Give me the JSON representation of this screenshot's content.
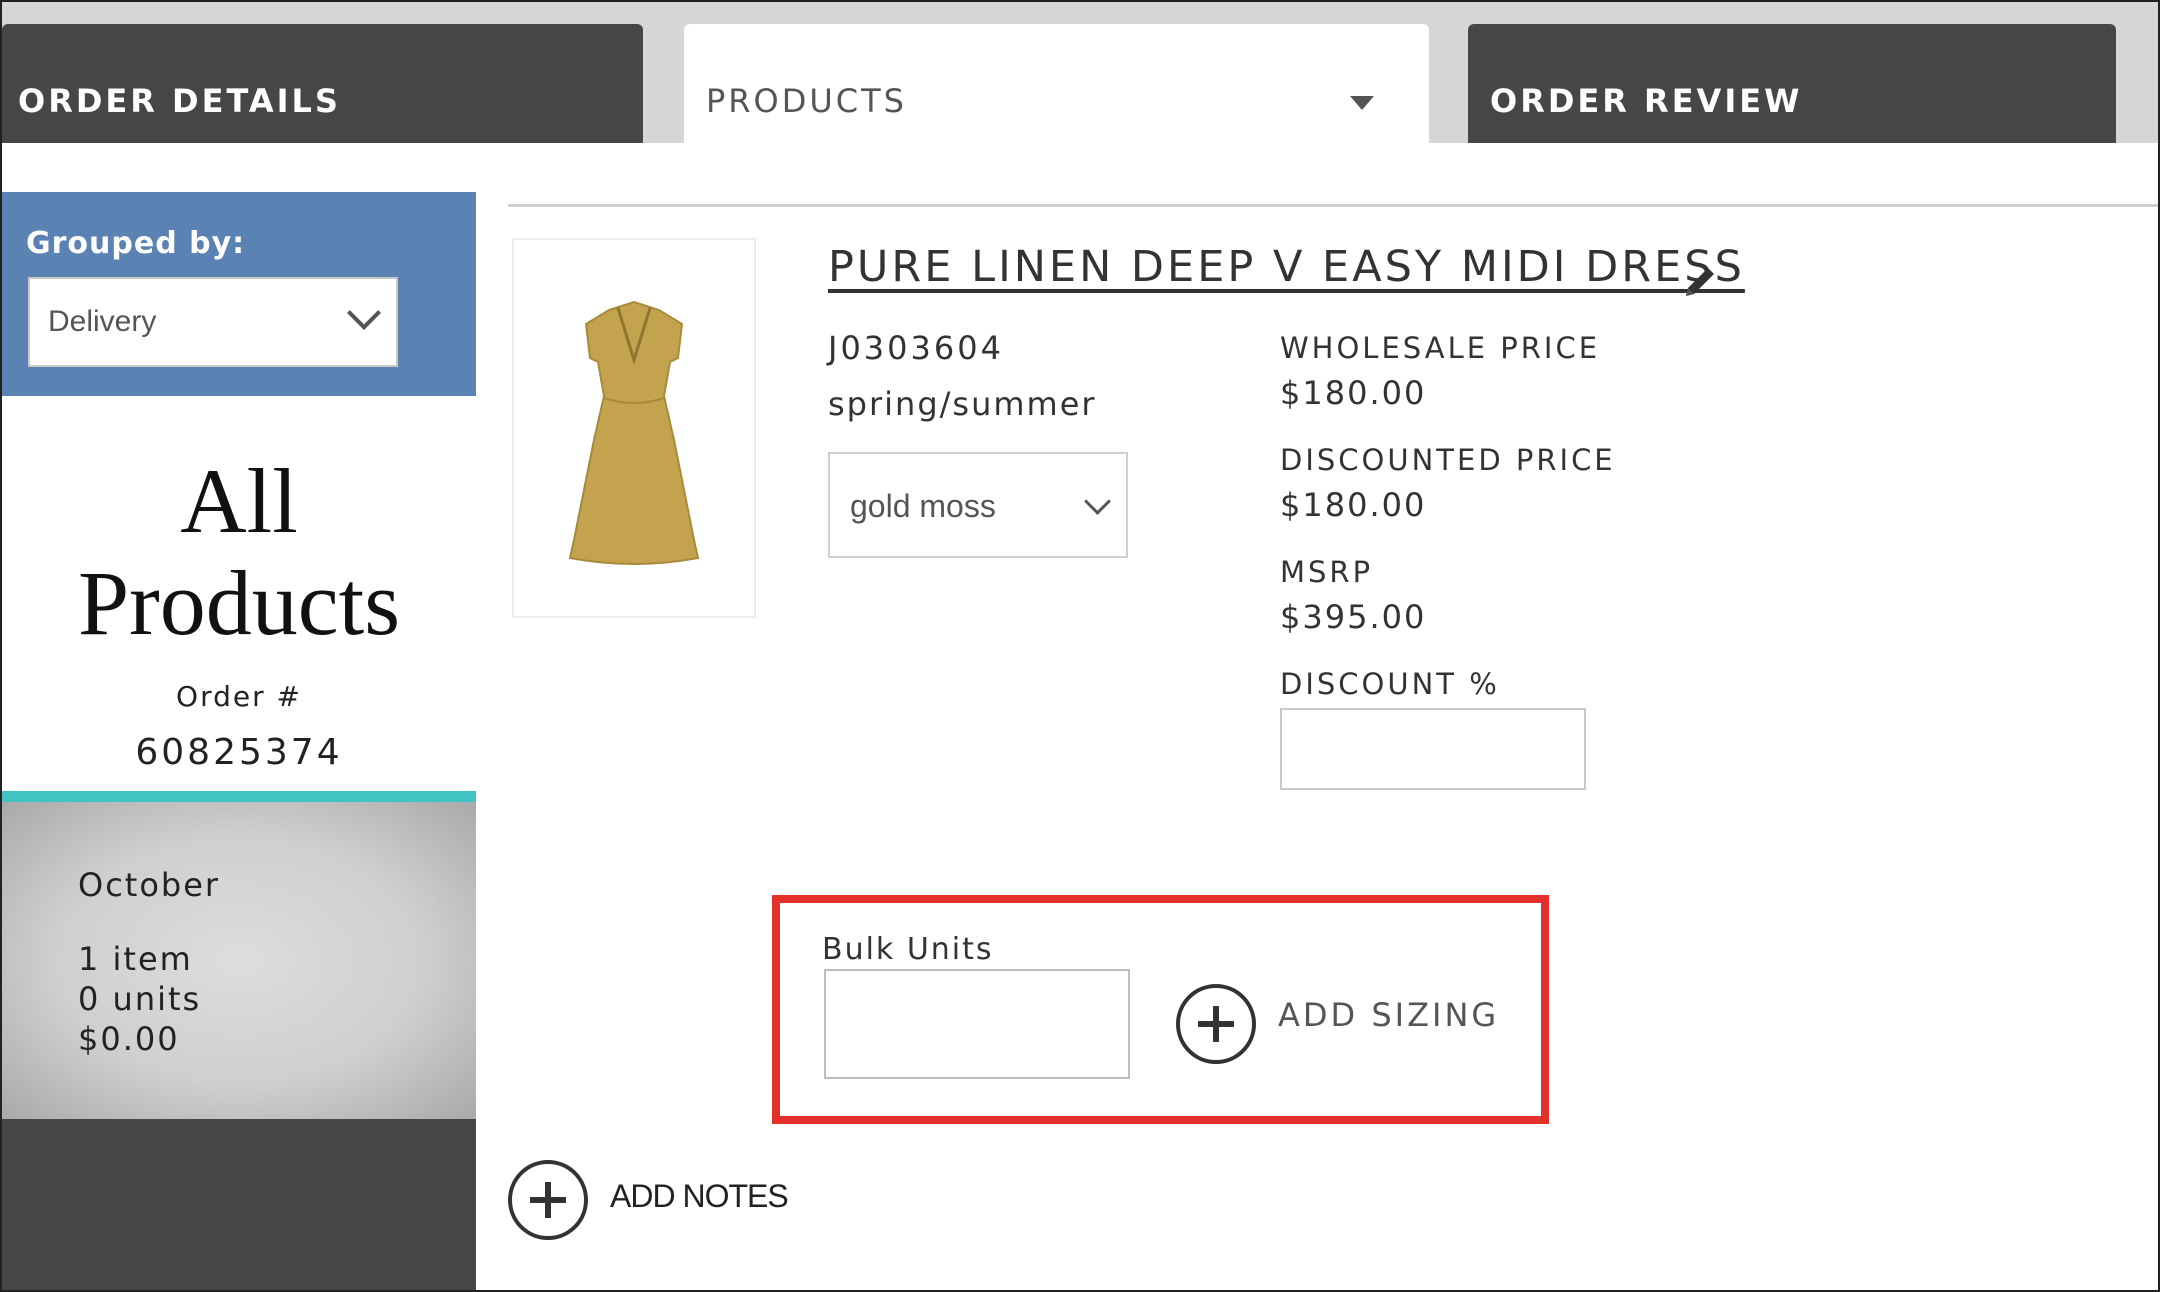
{
  "tabs": [
    {
      "label": "ORDER DETAILS",
      "active": false
    },
    {
      "label": "PRODUCTS",
      "active": true
    },
    {
      "label": "ORDER REVIEW",
      "active": false
    }
  ],
  "sidebar": {
    "grouped_by_label": "Grouped by:",
    "grouped_by_value": "Delivery",
    "title_line1": "All",
    "title_line2": "Products",
    "order_label": "Order #",
    "order_number": "60825374",
    "delivery_group": {
      "month": "October",
      "items": "1 item",
      "units": "0 units",
      "total": "$0.00"
    }
  },
  "product": {
    "name": "PURE LINEN DEEP V EASY MIDI DRESS",
    "sku": "J0303604",
    "season": "spring/summer",
    "color_selected": "gold moss",
    "wholesale_price_label": "WHOLESALE PRICE",
    "wholesale_price": "$180.00",
    "discounted_price_label": "DISCOUNTED PRICE",
    "discounted_price": "$180.00",
    "msrp_label": "MSRP",
    "msrp": "$395.00",
    "discount_label": "DISCOUNT %",
    "discount_value": ""
  },
  "bulk": {
    "label": "Bulk Units",
    "value": "",
    "add_sizing_label": "ADD SIZING"
  },
  "notes": {
    "add_notes_label": "ADD NOTES"
  },
  "colors": {
    "tab_dark": "#464646",
    "sidebar_blue": "#5a82b2",
    "teal_accent": "#3fc3c3",
    "highlight_red": "#e3302a",
    "dress": "#c4a34f"
  }
}
